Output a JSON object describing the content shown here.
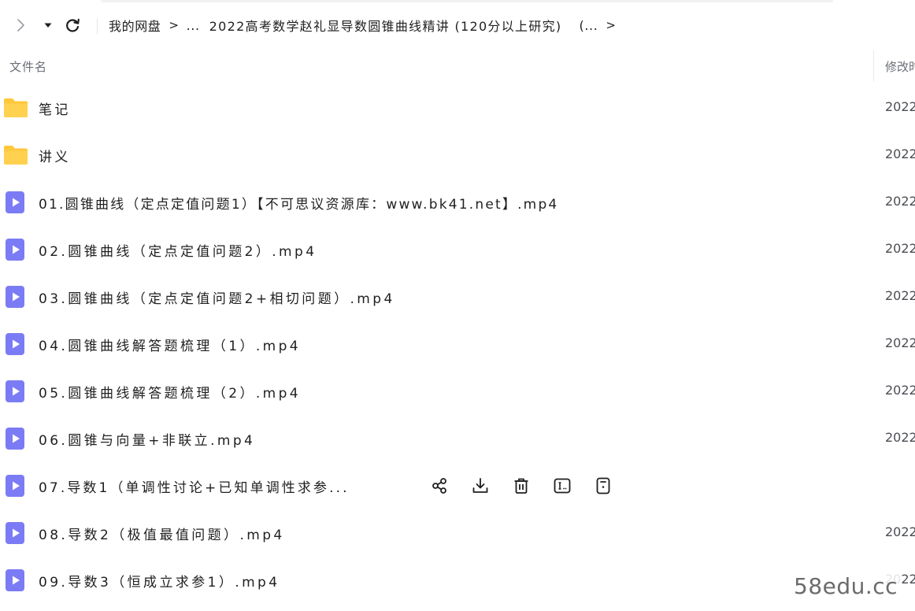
{
  "breadcrumb": {
    "root": "我的网盘",
    "separator": ">",
    "collapsed": "...",
    "folder": "2022高考数学赵礼显导数圆锥曲线精讲 (120分以上研究)",
    "trailing": "(...",
    "end_separator": ">"
  },
  "table": {
    "col_name": "文件名",
    "col_modified": "修改时"
  },
  "rows": [
    {
      "name": "笔记",
      "date": "2022",
      "type": "folder"
    },
    {
      "name": "讲义",
      "date": "2022",
      "type": "folder"
    },
    {
      "name": "01.圆锥曲线（定点定值问题1）【不可思议资源库：www.bk41.net】.mp4",
      "date": "2022",
      "type": "video"
    },
    {
      "name": "02.圆锥曲线（定点定值问题2）.mp4",
      "date": "2022",
      "type": "video"
    },
    {
      "name": "03.圆锥曲线（定点定值问题2+相切问题）.mp4",
      "date": "2022",
      "type": "video"
    },
    {
      "name": "04.圆锥曲线解答题梳理（1）.mp4",
      "date": "2022",
      "type": "video"
    },
    {
      "name": "05.圆锥曲线解答题梳理（2）.mp4",
      "date": "2022",
      "type": "video"
    },
    {
      "name": "06.圆锥与向量+非联立.mp4",
      "date": "2022",
      "type": "video"
    },
    {
      "name": "07.导数1（单调性讨论+已知单调性求参...",
      "date": "",
      "type": "video"
    },
    {
      "name": "08.导数2（极值最值问题）.mp4",
      "date": "2022",
      "type": "video"
    },
    {
      "name": "09.导数3（恒成立求参1）.mp4",
      "date": "2022",
      "type": "video"
    }
  ],
  "row_actions": [
    "share-icon",
    "download-icon",
    "delete-icon",
    "rename-icon",
    "more-icon"
  ],
  "watermark": "58edu.cc",
  "colors": {
    "folder": "#FFC73B",
    "video": "#7B7CF5",
    "text": "#1f1f1f",
    "muted": "#6b6f76"
  }
}
